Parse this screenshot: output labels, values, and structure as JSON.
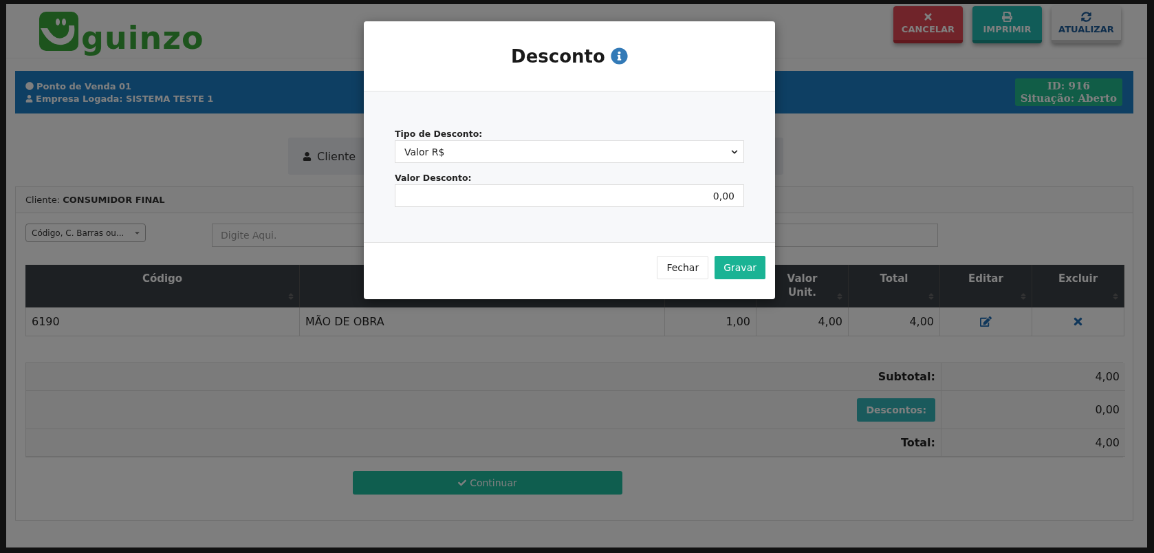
{
  "logo": {
    "text": "guinzo"
  },
  "toolbar": [
    {
      "label": "CANCELAR",
      "kind": "cancel"
    },
    {
      "label": "IMPRIMIR",
      "kind": "print"
    },
    {
      "label": "ATUALIZAR",
      "kind": "refresh"
    }
  ],
  "info_bar": {
    "terminal": "Ponto de Venda 01",
    "company": "Empresa Logada: SISTEMA TESTE 1",
    "id": "ID: 916",
    "status": "Situação: Aberto"
  },
  "tab": {
    "label": "Cliente"
  },
  "card": {
    "client_label": "Cliente:",
    "client_name": "CONSUMIDOR FINAL",
    "search_type": "Código, C. Barras ou...",
    "search": {
      "placeholder": "Digite Aqui."
    }
  },
  "table": {
    "columns": [
      "Código",
      "Valor Unit.",
      "Total",
      "Editar",
      "Excluir"
    ],
    "rows": [
      {
        "cells": [
          "6190",
          "MÃO DE OBRA",
          "1,00",
          "4,00",
          "4,00"
        ]
      }
    ]
  },
  "totals": [
    {
      "kind": "label",
      "label": "Subtotal:",
      "value": "4,00"
    },
    {
      "kind": "button",
      "label": "Descontos:",
      "value": "0,00"
    },
    {
      "kind": "label",
      "label": "Total:",
      "value": "4,00"
    }
  ],
  "continue_button": {
    "label": "Continuar"
  },
  "modal": {
    "title": "Desconto",
    "fields": [
      {
        "kind": "select",
        "label": "Tipo de Desconto:",
        "value": "Valor R$"
      },
      {
        "kind": "input",
        "label": "Valor Desconto:",
        "value": "0,00"
      }
    ],
    "buttons": [
      {
        "label": "Fechar",
        "kind": "secondary"
      },
      {
        "label": "Gravar",
        "kind": "primary"
      }
    ]
  }
}
